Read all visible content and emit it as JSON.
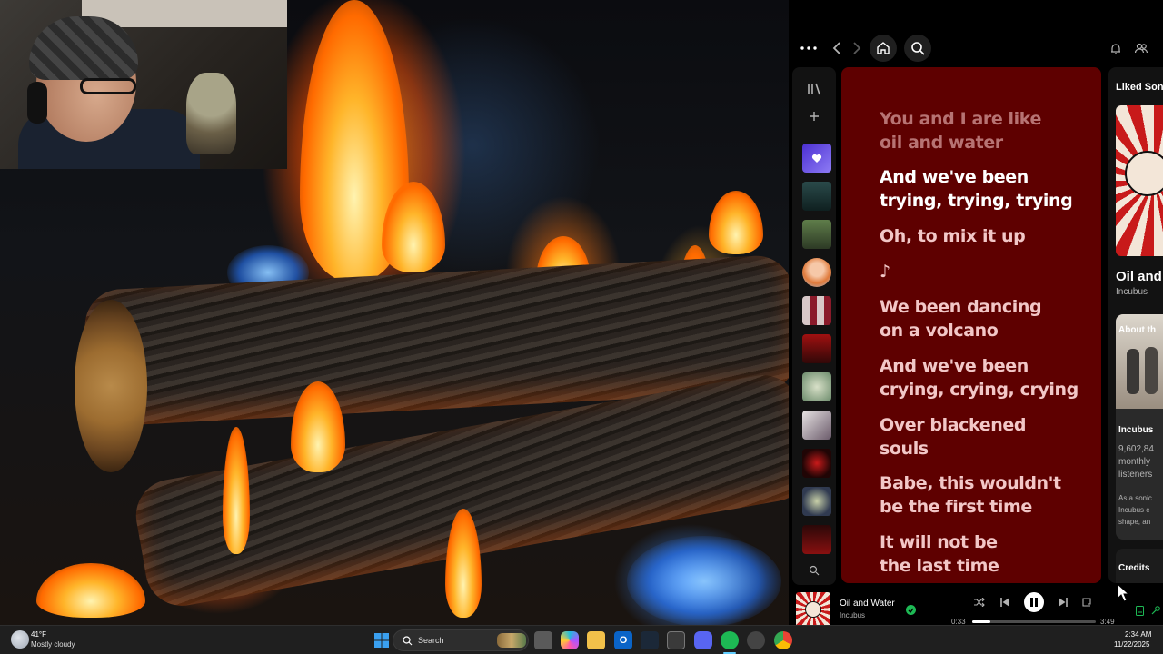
{
  "webcam": {
    "label": "Streamer webcam"
  },
  "spotify": {
    "topbar": {
      "menu_icon": "more-horizontal-icon",
      "back_icon": "chevron-left-icon",
      "forward_icon": "chevron-right-icon",
      "home_icon": "home-icon",
      "search_icon": "search-icon",
      "bell_icon": "bell-icon",
      "friends_icon": "friends-icon"
    },
    "lyrics": [
      {
        "line1": "You and I are like",
        "line2": "oil and water",
        "state": "past"
      },
      {
        "line1": "And we've been",
        "line2": "trying, trying, trying",
        "state": "active"
      },
      {
        "line1": "Oh, to mix it up",
        "line2": "",
        "state": "future"
      },
      {
        "line1": "♪",
        "line2": "",
        "state": "future"
      },
      {
        "line1": "We been dancing",
        "line2": "on a volcano",
        "state": "future"
      },
      {
        "line1": "And we've been",
        "line2": "crying, crying, crying",
        "state": "future"
      },
      {
        "line1": "Over blackened",
        "line2": "souls",
        "state": "future"
      },
      {
        "line1": "Babe, this wouldn't",
        "line2": "be the first time",
        "state": "future"
      },
      {
        "line1": "It will not be",
        "line2": "the last time",
        "state": "future"
      }
    ],
    "right_panel": {
      "heading": "Liked Song",
      "song_title": "Oil and",
      "artist": "Incubus",
      "about_label": "About th",
      "artist_name": "Incubus",
      "listeners_line1": "9,602,84",
      "listeners_line2": "monthly",
      "listeners_line3": "listeners",
      "bio_line1": "As a sonic",
      "bio_line2": "Incubus c",
      "bio_line3": "shape, an",
      "credits": "Credits"
    },
    "player": {
      "track_title": "Oil and Water",
      "track_artist": "Incubus",
      "elapsed": "0:33",
      "duration": "3:49",
      "progress": 0.144
    }
  },
  "taskbar": {
    "weather_temp": "41°F",
    "weather_desc": "Mostly cloudy",
    "search_placeholder": "Search",
    "time": "2:34 AM",
    "date": "11/22/2025"
  },
  "colors": {
    "lyrics_bg": "#5e0000",
    "spotify_green": "#1db954",
    "taskbar_bg": "#1f1f1f"
  }
}
